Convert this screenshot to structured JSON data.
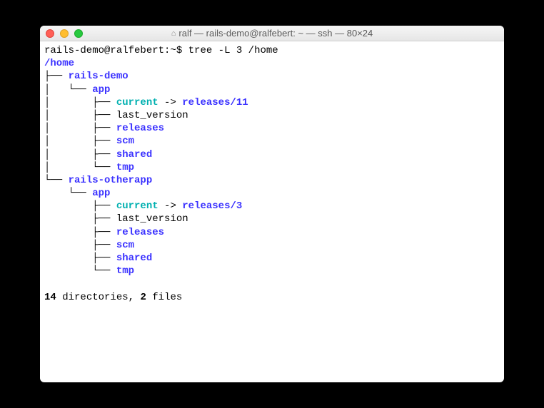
{
  "window": {
    "title_prefix_icon": "⌂",
    "title": "ralf — rails-demo@ralfebert: ~ — ssh — 80×24"
  },
  "prompt": {
    "user_host": "rails-demo@ralfebert",
    "path": "~",
    "symbol": "$",
    "command": "tree -L 3 /home"
  },
  "tree": {
    "root": "/home",
    "app1_name": "rails-demo",
    "app1_dir": "app",
    "app1_current": "current",
    "app1_current_target": "releases/11",
    "app1_last_version": "last_version",
    "app1_releases": "releases",
    "app1_scm": "scm",
    "app1_shared": "shared",
    "app1_tmp": "tmp",
    "app2_name": "rails-otherapp",
    "app2_dir": "app",
    "app2_current": "current",
    "app2_current_target": "releases/3",
    "app2_last_version": "last_version",
    "app2_releases": "releases",
    "app2_scm": "scm",
    "app2_shared": "shared",
    "app2_tmp": "tmp"
  },
  "summary": {
    "dirs_count": "14",
    "dirs_label": "directories,",
    "files_count": "2",
    "files_label": "files"
  },
  "arrow": "->"
}
